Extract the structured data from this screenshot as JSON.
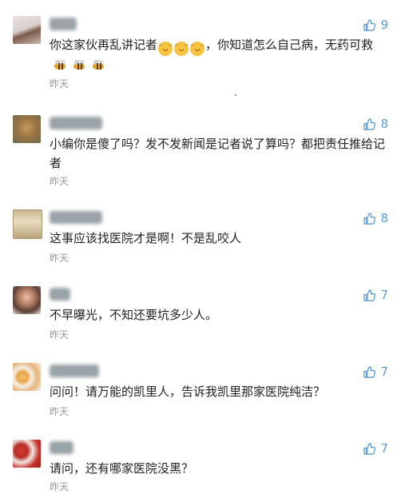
{
  "colors": {
    "accent": "#5b9bd5",
    "time": "#999999",
    "text": "#222222"
  },
  "comments": [
    {
      "likes": "9",
      "text_before": "你这家伙再乱讲记者",
      "text_after": "，你知道怎么自己病，无药可救",
      "emoji_count": 3,
      "time": "昨天"
    },
    {
      "likes": "8",
      "text": "小编你是傻了吗？发不发新闻是记者说了算吗？都把责任推给记者",
      "time": "昨天"
    },
    {
      "likes": "8",
      "text": "这事应该找医院才是啊！不是乱咬人",
      "time": "昨天"
    },
    {
      "likes": "7",
      "text": "不早曝光，不知还要坑多少人。",
      "time": "昨天"
    },
    {
      "likes": "7",
      "text": "问问！请万能的凯里人，告诉我凯里那家医院纯洁？",
      "time": "昨天"
    },
    {
      "likes": "7",
      "text": "请问，还有哪家医院没黑？",
      "time": "昨天"
    }
  ]
}
